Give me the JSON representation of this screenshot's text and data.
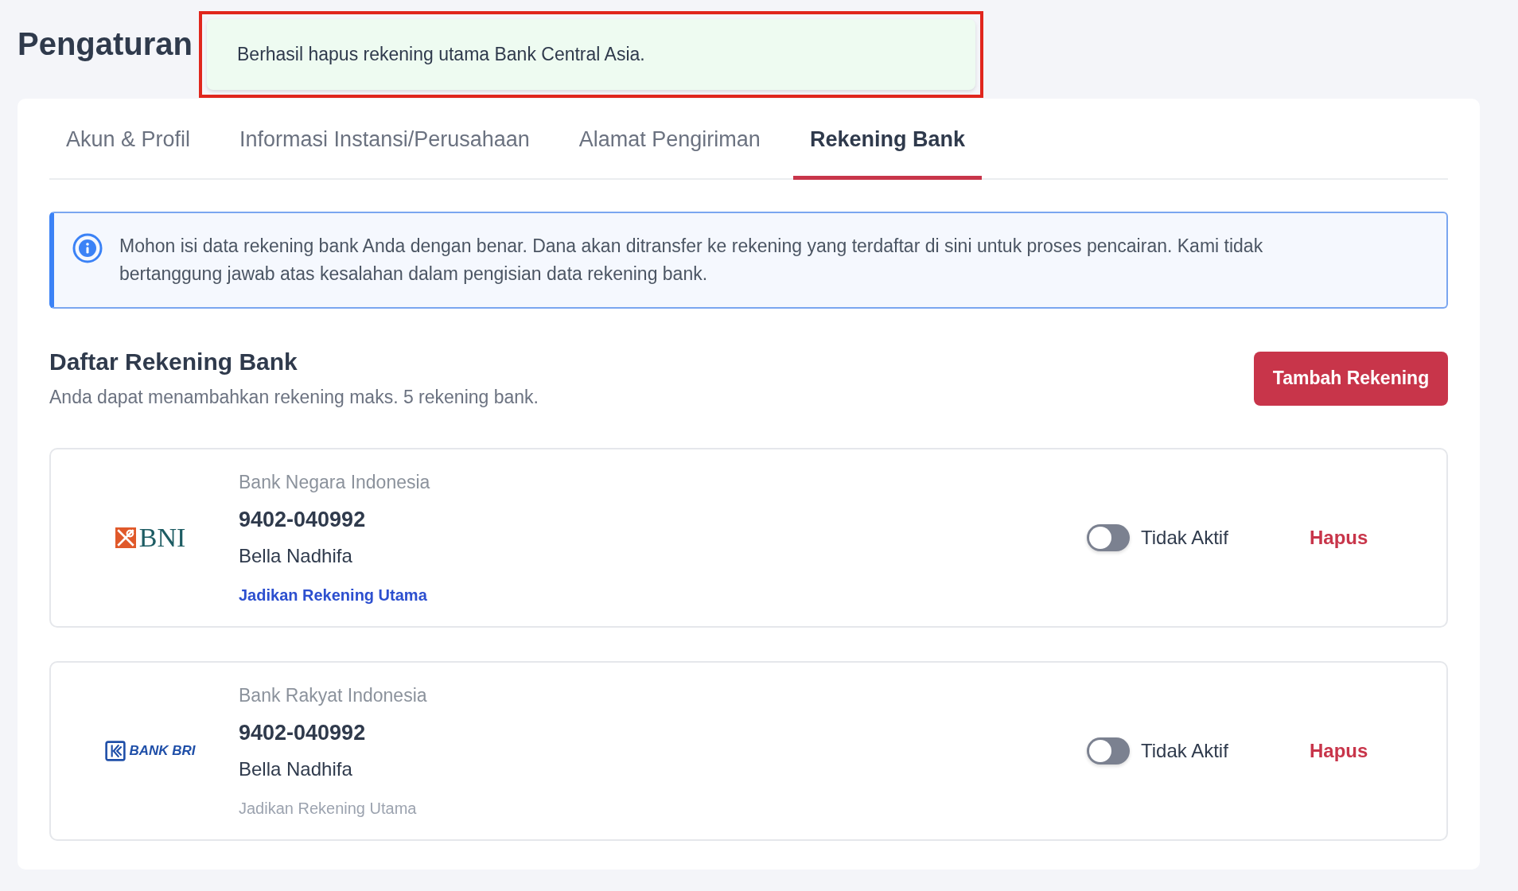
{
  "page_title": "Pengaturan",
  "toast": {
    "message": "Berhasil hapus rekening utama Bank Central Asia.",
    "highlighted": true
  },
  "tabs": [
    {
      "label": "Akun & Profil",
      "selected": false
    },
    {
      "label": "Informasi Instansi/Perusahaan",
      "selected": false
    },
    {
      "label": "Alamat Pengiriman",
      "selected": false
    },
    {
      "label": "Rekening Bank",
      "selected": true
    }
  ],
  "info_notice": "Mohon isi data rekening bank Anda dengan benar. Dana akan ditransfer ke rekening yang terdaftar di sini untuk proses pencairan. Kami tidak bertanggung jawab atas kesalahan dalam pengisian data rekening bank.",
  "section": {
    "title": "Daftar Rekening Bank",
    "subtitle": "Anda dapat menambahkan rekening maks. 5 rekening bank.",
    "add_button": "Tambah Rekening"
  },
  "accounts": [
    {
      "logo": {
        "kind": "bni",
        "text": "BNI"
      },
      "bank_name": "Bank Negara Indonesia",
      "number": "9402-040992",
      "holder": "Bella Nadhifa",
      "make_primary": {
        "label": "Jadikan Rekening Utama",
        "disabled": false
      },
      "toggle": {
        "on": false,
        "label": "Tidak Aktif"
      },
      "delete": "Hapus"
    },
    {
      "logo": {
        "kind": "bri",
        "text": "BANK BRI"
      },
      "bank_name": "Bank Rakyat Indonesia",
      "number": "9402-040992",
      "holder": "Bella Nadhifa",
      "make_primary": {
        "label": "Jadikan Rekening Utama",
        "disabled": true
      },
      "toggle": {
        "on": false,
        "label": "Tidak Aktif"
      },
      "delete": "Hapus"
    }
  ]
}
